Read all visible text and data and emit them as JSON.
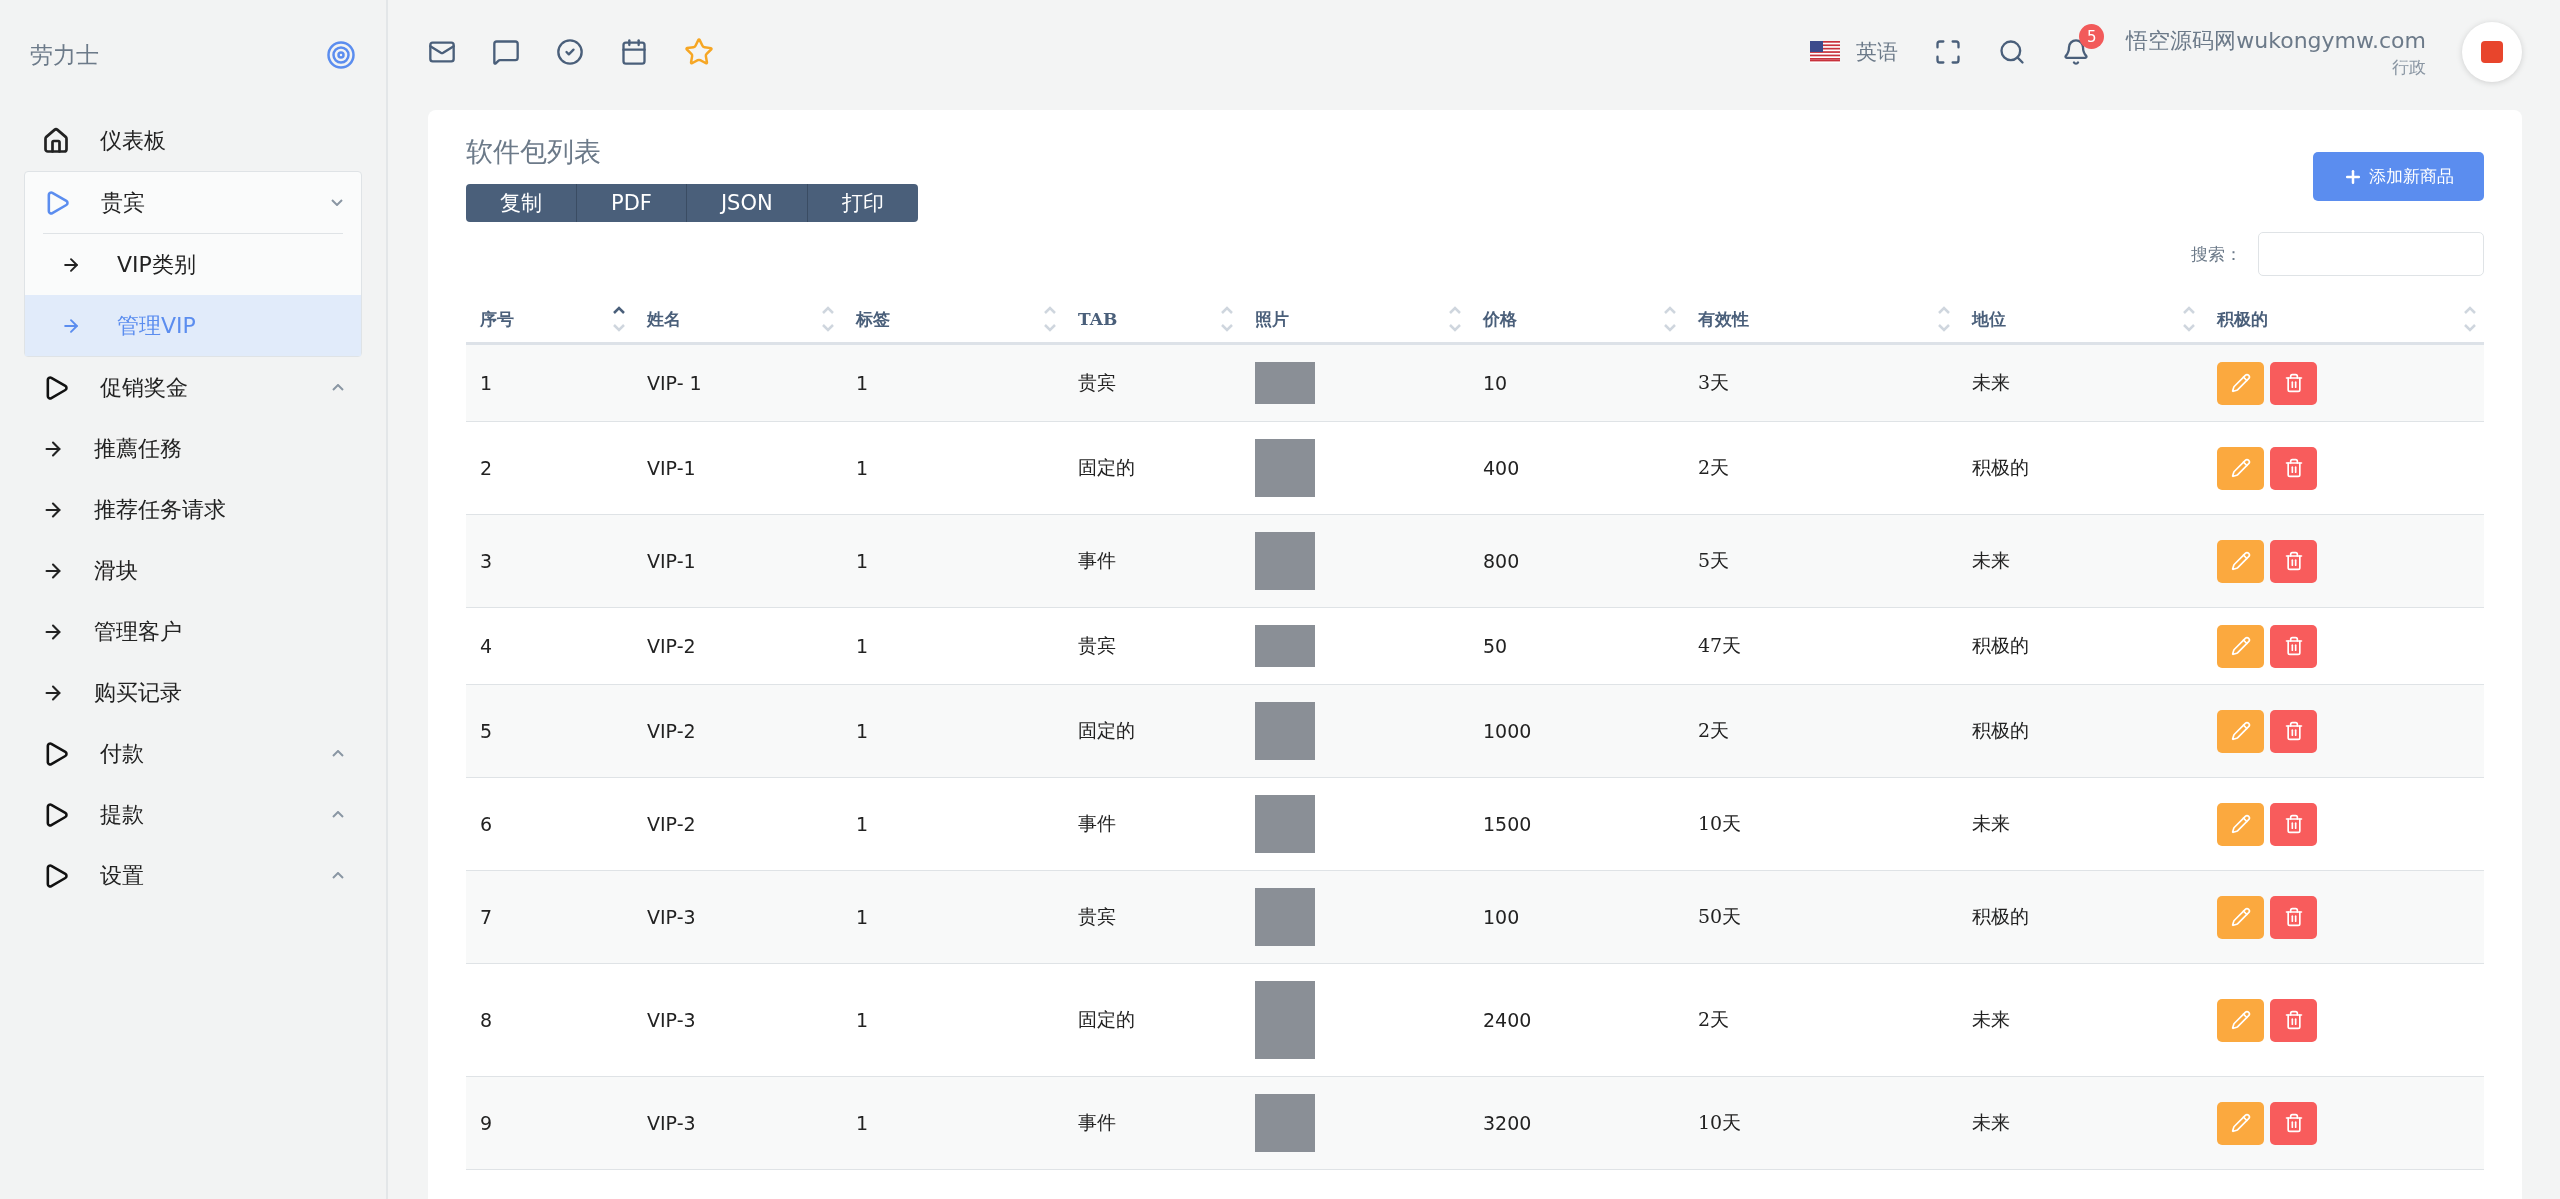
{
  "brand": {
    "title": "劳力士"
  },
  "sidebar": {
    "items": [
      {
        "kind": "home",
        "label": "仪表板",
        "selected": false
      },
      {
        "kind": "group",
        "label": "贵宾",
        "expanded": true,
        "children": [
          {
            "label": "VIP类别",
            "selected": false
          },
          {
            "label": "管理VIP",
            "selected": true
          }
        ]
      },
      {
        "kind": "group",
        "label": "促销奖金",
        "expanded": false
      },
      {
        "kind": "link",
        "label": "推薦任務",
        "selected": false
      },
      {
        "kind": "link",
        "label": "推荐任务请求",
        "selected": false
      },
      {
        "kind": "link",
        "label": "滑块",
        "selected": false
      },
      {
        "kind": "link",
        "label": "管理客户",
        "selected": false
      },
      {
        "kind": "link",
        "label": "购买记录",
        "selected": false
      },
      {
        "kind": "group",
        "label": "付款",
        "expanded": false
      },
      {
        "kind": "group",
        "label": "提款",
        "expanded": false
      },
      {
        "kind": "group",
        "label": "设置",
        "expanded": false
      }
    ]
  },
  "topbar": {
    "language": "英语",
    "notifications": "5",
    "user_name": "悟空源码网wukongymw.com",
    "user_role": "行政"
  },
  "card": {
    "title": "软件包列表",
    "export_buttons": [
      "复制",
      "PDF",
      "JSON",
      "打印"
    ],
    "add_button": "添加新商品",
    "search_label": "搜索："
  },
  "table": {
    "columns": [
      {
        "label": "序号",
        "sorted": true
      },
      {
        "label": "姓名",
        "sorted": false
      },
      {
        "label": "标签",
        "sorted": false
      },
      {
        "label": "TAB",
        "sorted": false
      },
      {
        "label": "照片",
        "sorted": false
      },
      {
        "label": "价格",
        "sorted": false
      },
      {
        "label": "有效性",
        "sorted": false
      },
      {
        "label": "地位",
        "sorted": false
      },
      {
        "label": "积极的",
        "sorted": false
      }
    ],
    "rows": [
      {
        "no": "1",
        "name": "VIP- 1",
        "tag": "1",
        "tab": "贵宾",
        "price": "10",
        "validity": "3天",
        "status": "未来"
      },
      {
        "no": "2",
        "name": "VIP-1",
        "tag": "1",
        "tab": "固定的",
        "price": "400",
        "validity": "2天",
        "status": "积极的"
      },
      {
        "no": "3",
        "name": "VIP-1",
        "tag": "1",
        "tab": "事件",
        "price": "800",
        "validity": "5天",
        "status": "未来"
      },
      {
        "no": "4",
        "name": "VIP-2",
        "tag": "1",
        "tab": "贵宾",
        "price": "50",
        "validity": "47天",
        "status": "积极的"
      },
      {
        "no": "5",
        "name": "VIP-2",
        "tag": "1",
        "tab": "固定的",
        "price": "1000",
        "validity": "2天",
        "status": "积极的"
      },
      {
        "no": "6",
        "name": "VIP-2",
        "tag": "1",
        "tab": "事件",
        "price": "1500",
        "validity": "10天",
        "status": "未来"
      },
      {
        "no": "7",
        "name": "VIP-3",
        "tag": "1",
        "tab": "贵宾",
        "price": "100",
        "validity": "50天",
        "status": "积极的"
      },
      {
        "no": "8",
        "name": "VIP-3",
        "tag": "1",
        "tab": "固定的",
        "price": "2400",
        "validity": "2天",
        "status": "未来"
      },
      {
        "no": "9",
        "name": "VIP-3",
        "tag": "1",
        "tab": "事件",
        "price": "3200",
        "validity": "10天",
        "status": "未来"
      }
    ]
  }
}
